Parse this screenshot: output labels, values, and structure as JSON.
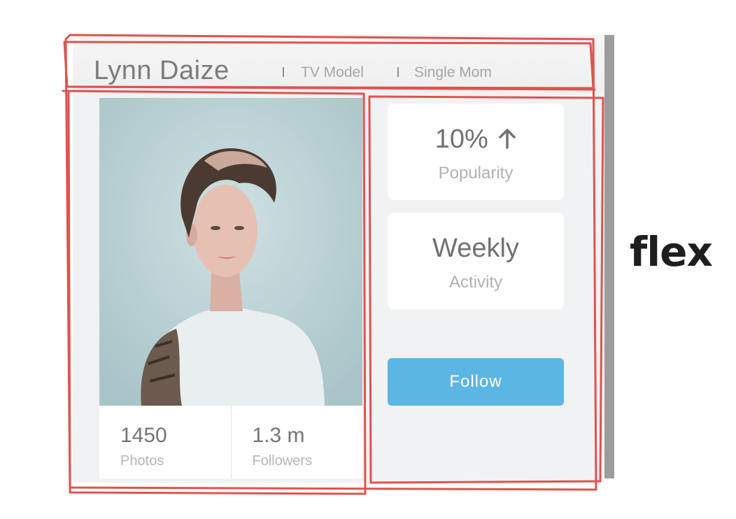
{
  "profile": {
    "name": "Lynn Daize",
    "tags": [
      "TV Model",
      "Single Mom"
    ]
  },
  "stats": [
    {
      "value": "1450",
      "label": "Photos"
    },
    {
      "value": "1.3 m",
      "label": "Followers"
    }
  ],
  "metrics": [
    {
      "value": "10%",
      "icon": "arrow-up-icon",
      "label": "Popularity"
    },
    {
      "value": "Weekly",
      "label": "Activity"
    }
  ],
  "actions": {
    "follow_label": "Follow"
  },
  "annotation": {
    "text": "flex"
  },
  "colors": {
    "accent": "#5cb6e4",
    "sketch": "#e0524f",
    "card_bg": "#f1f2f3"
  }
}
